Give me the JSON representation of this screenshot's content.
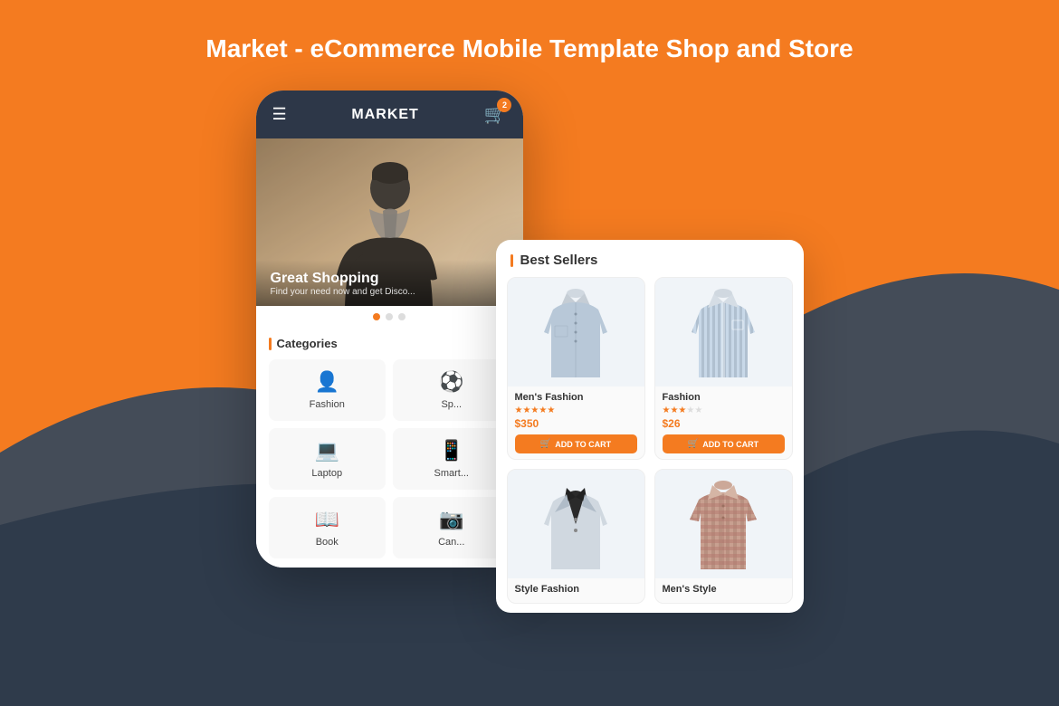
{
  "page": {
    "title": "Market - eCommerce Mobile Template Shop and Store",
    "bg_color": "#F47B20"
  },
  "phone": {
    "header": {
      "title": "MARKET",
      "cart_count": "2"
    },
    "hero": {
      "title": "Great Shopping",
      "subtitle": "Find your need now and get Disco...",
      "dots": [
        true,
        false,
        false
      ]
    },
    "categories": {
      "section_title": "Categories",
      "items": [
        {
          "icon": "👤",
          "label": "Fashion"
        },
        {
          "icon": "⚽",
          "label": "Sp..."
        },
        {
          "icon": "💻",
          "label": "Laptop"
        },
        {
          "icon": "📱",
          "label": "Smart..."
        },
        {
          "icon": "📖",
          "label": "Book"
        },
        {
          "icon": "📷",
          "label": "Can..."
        }
      ]
    }
  },
  "best_sellers": {
    "section_title": "Best Sellers",
    "products": [
      {
        "name": "Men's Fashion",
        "stars": 5,
        "price": "$350",
        "add_to_cart": "ADD TO CART",
        "shirt_color": "#b8c8d8",
        "stripe": false
      },
      {
        "name": "Fashion",
        "stars": 3,
        "price": "$26",
        "add_to_cart": "ADD TO CART",
        "shirt_color": "#a8b8c8",
        "stripe": true
      },
      {
        "name": "Style Fashion",
        "stars": 0,
        "price": "",
        "add_to_cart": "",
        "shirt_color": "#c8d0d8",
        "stripe": false
      },
      {
        "name": "Men's Style",
        "stars": 0,
        "price": "",
        "add_to_cart": "",
        "shirt_color": "#c8a0a0",
        "stripe": true
      }
    ]
  }
}
